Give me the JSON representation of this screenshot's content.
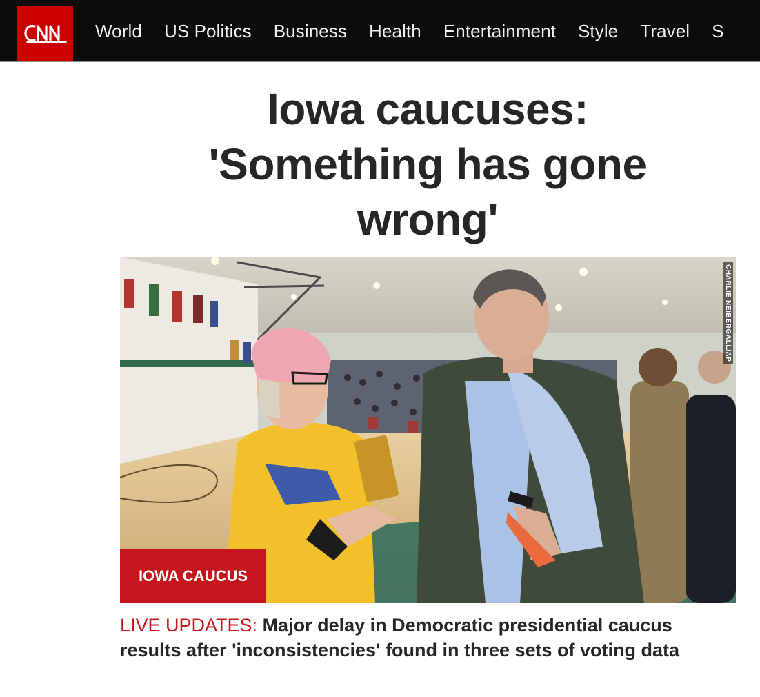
{
  "header": {
    "logo_text": "CNN",
    "brand_color": "#cc0000",
    "nav": [
      "World",
      "US Politics",
      "Business",
      "Health",
      "Entertainment",
      "Style",
      "Travel",
      "S"
    ]
  },
  "article": {
    "headline": "Iowa caucuses: 'Something has gone wrong'",
    "image": {
      "credit": "CHARLIE NEIBERGALL/AP",
      "tag": "IOWA CAUCUS"
    },
    "caption_prefix": "LIVE UPDATES:",
    "caption_text": " Major delay in Democratic presidential caucus results after 'inconsistencies' found in three sets of voting data"
  }
}
